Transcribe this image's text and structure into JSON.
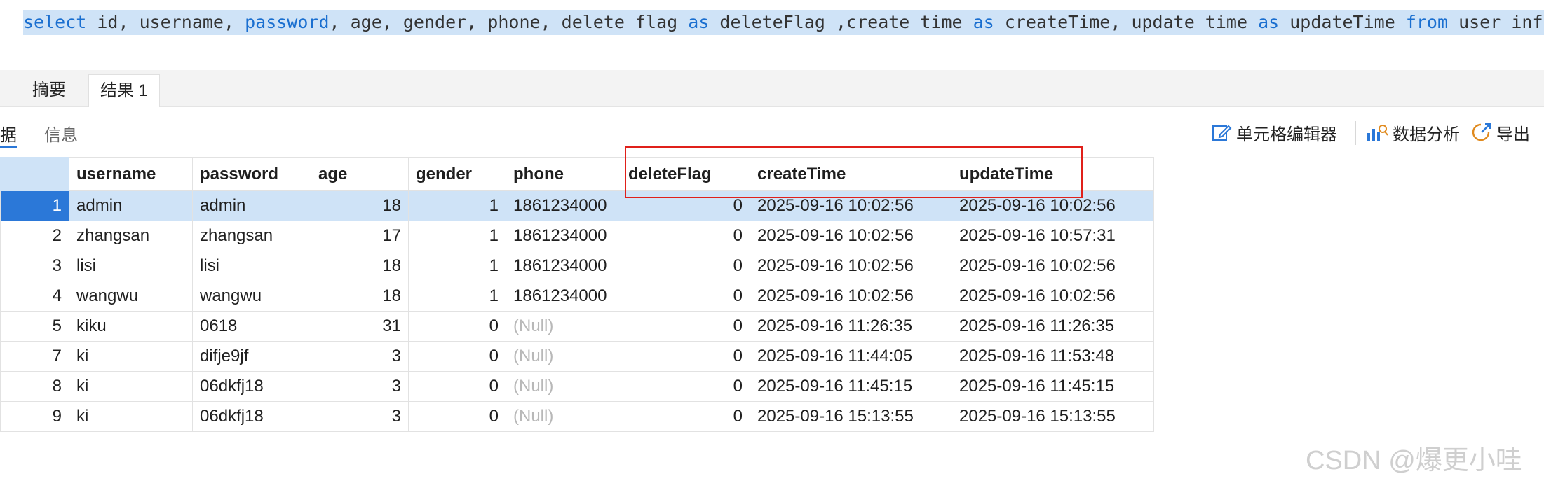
{
  "editor": {
    "sql_tokens": [
      {
        "t": "select",
        "kw": true
      },
      {
        "t": " id, username, ",
        "kw": false
      },
      {
        "t": "password",
        "kw": true
      },
      {
        "t": ", age, gender, phone, delete_flag ",
        "kw": false
      },
      {
        "t": "as",
        "kw": true
      },
      {
        "t": " deleteFlag ,create_time ",
        "kw": false
      },
      {
        "t": "as",
        "kw": true
      },
      {
        "t": " createTime, update_time ",
        "kw": false
      },
      {
        "t": "as",
        "kw": true
      },
      {
        "t": " updateTime ",
        "kw": false
      },
      {
        "t": "from",
        "kw": true
      },
      {
        "t": " user_info",
        "kw": false
      }
    ]
  },
  "tabs": [
    {
      "label": "摘要",
      "active": false
    },
    {
      "label": "结果 1",
      "active": true
    }
  ],
  "subtabs": {
    "data_partial": "据",
    "info": "信息"
  },
  "toolbar": {
    "cell_editor": "单元格编辑器",
    "data_analysis": "数据分析",
    "export": "导出"
  },
  "grid": {
    "columns": [
      "username",
      "password",
      "age",
      "gender",
      "phone",
      "deleteFlag",
      "createTime",
      "updateTime"
    ],
    "rows": [
      {
        "rownum": "1",
        "username": "admin",
        "password": "admin",
        "age": "18",
        "gender": "1",
        "phone": "1861234000",
        "deleteFlag": "0",
        "createTime": "2025-09-16 10:02:56",
        "updateTime": "2025-09-16 10:02:56",
        "selected": true
      },
      {
        "rownum": "2",
        "username": "zhangsan",
        "password": "zhangsan",
        "age": "17",
        "gender": "1",
        "phone": "1861234000",
        "deleteFlag": "0",
        "createTime": "2025-09-16 10:02:56",
        "updateTime": "2025-09-16 10:57:31"
      },
      {
        "rownum": "3",
        "username": "lisi",
        "password": "lisi",
        "age": "18",
        "gender": "1",
        "phone": "1861234000",
        "deleteFlag": "0",
        "createTime": "2025-09-16 10:02:56",
        "updateTime": "2025-09-16 10:02:56"
      },
      {
        "rownum": "4",
        "username": "wangwu",
        "password": "wangwu",
        "age": "18",
        "gender": "1",
        "phone": "1861234000",
        "deleteFlag": "0",
        "createTime": "2025-09-16 10:02:56",
        "updateTime": "2025-09-16 10:02:56"
      },
      {
        "rownum": "5",
        "username": "kiku",
        "password": "0618",
        "age": "31",
        "gender": "0",
        "phone": "(Null)",
        "deleteFlag": "0",
        "createTime": "2025-09-16 11:26:35",
        "updateTime": "2025-09-16 11:26:35"
      },
      {
        "rownum": "7",
        "username": "ki",
        "password": "difje9jf",
        "age": "3",
        "gender": "0",
        "phone": "(Null)",
        "deleteFlag": "0",
        "createTime": "2025-09-16 11:44:05",
        "updateTime": "2025-09-16 11:53:48"
      },
      {
        "rownum": "8",
        "username": "ki",
        "password": "06dkfj18",
        "age": "3",
        "gender": "0",
        "phone": "(Null)",
        "deleteFlag": "0",
        "createTime": "2025-09-16 11:45:15",
        "updateTime": "2025-09-16 11:45:15"
      },
      {
        "rownum": "9",
        "username": "ki",
        "password": "06dkfj18",
        "age": "3",
        "gender": "0",
        "phone": "(Null)",
        "deleteFlag": "0",
        "createTime": "2025-09-16 15:13:55",
        "updateTime": "2025-09-16 15:13:55"
      }
    ]
  },
  "watermark": "CSDN @爆更小哇",
  "colors": {
    "selection": "#cfe3f7",
    "accent": "#2b78d8",
    "keyword": "#1a6fd0",
    "highlight_box": "#e0201a"
  }
}
